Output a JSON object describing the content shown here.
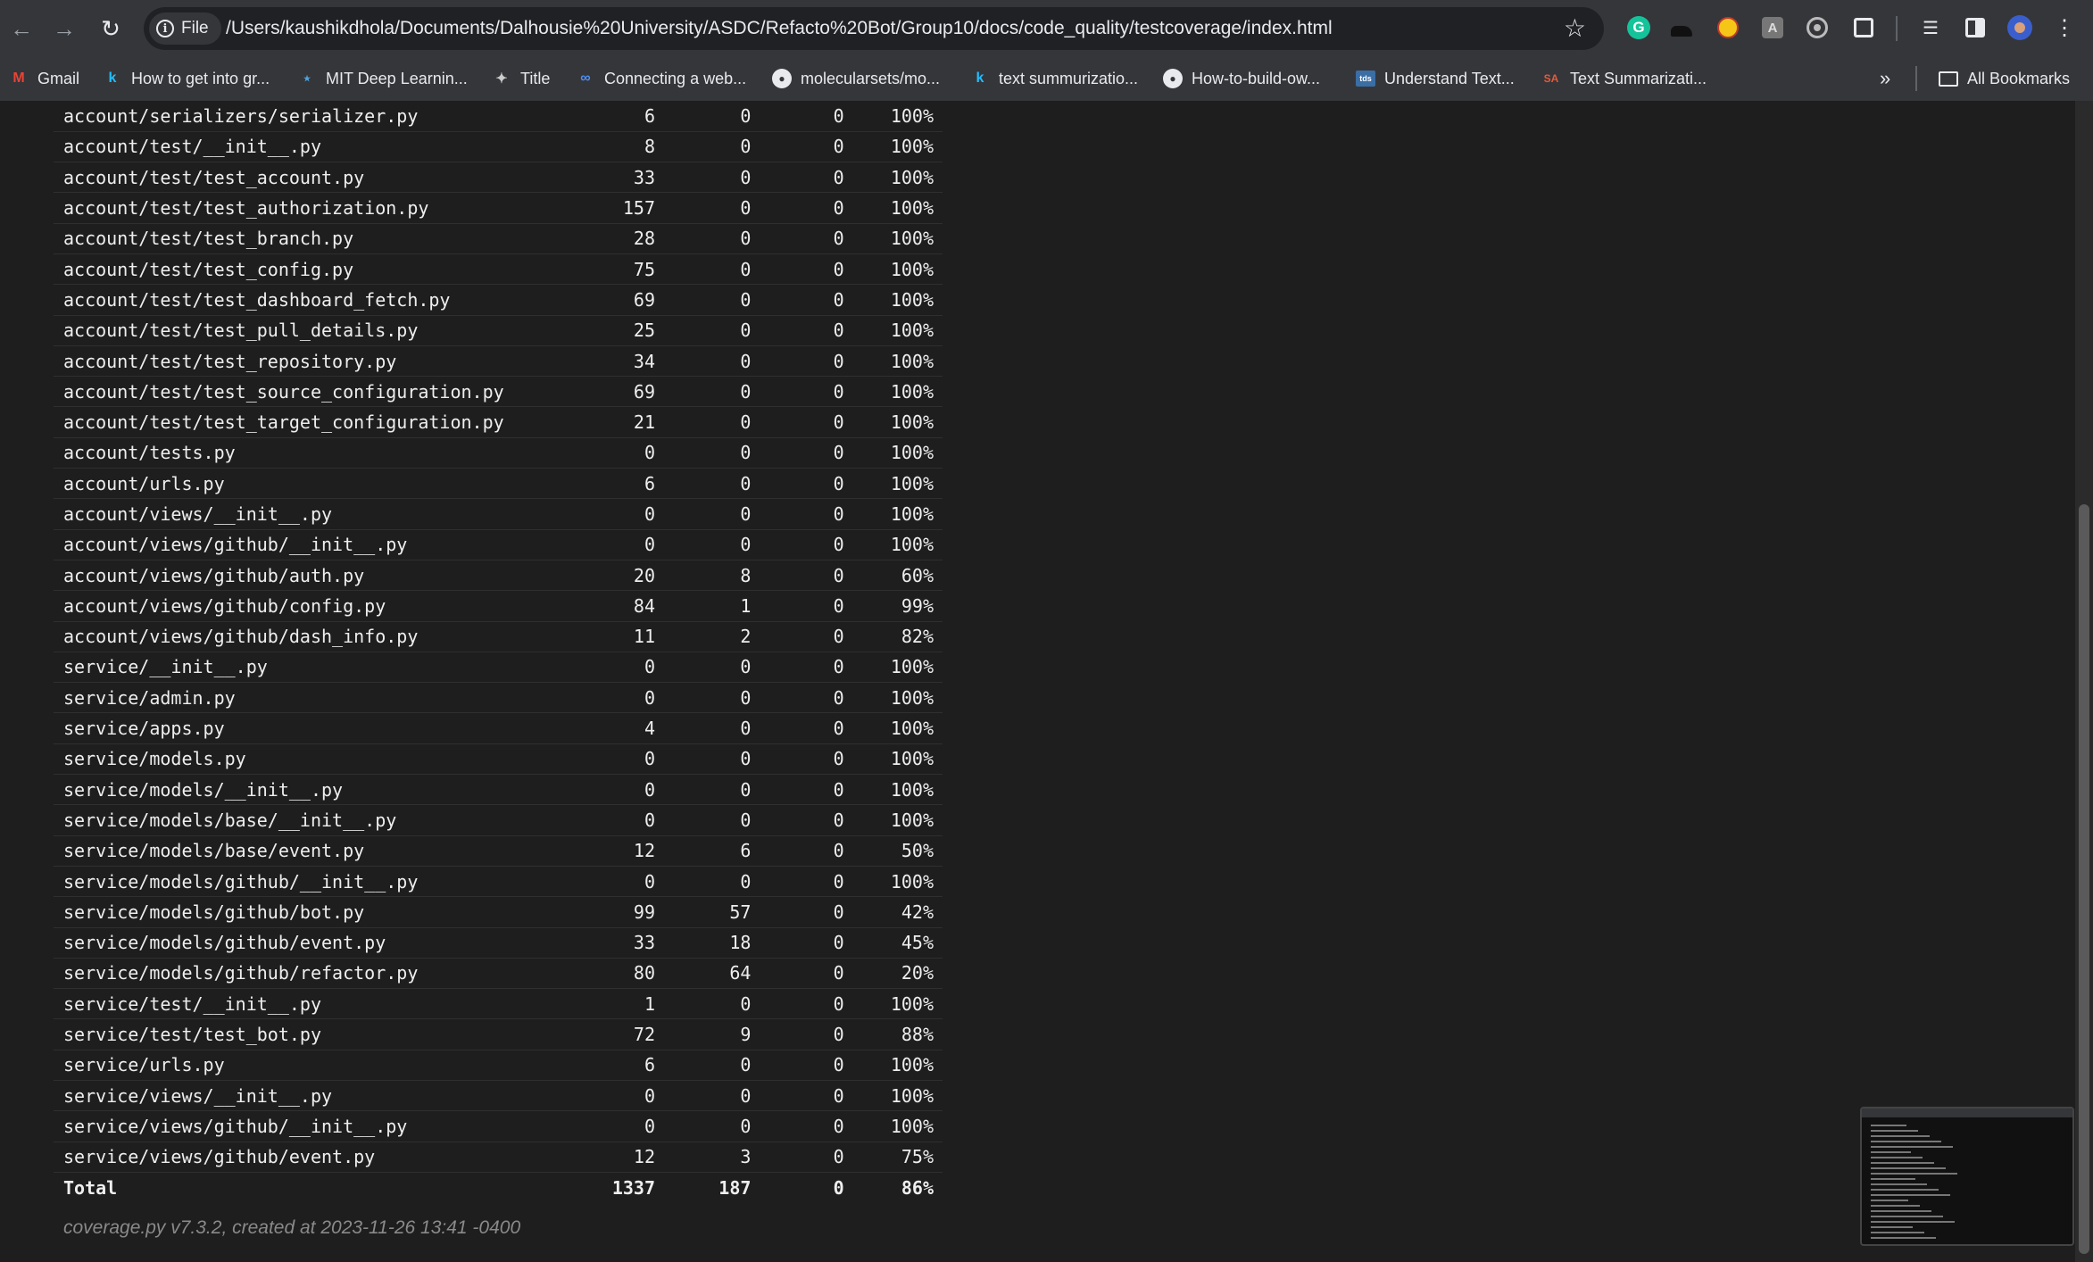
{
  "browser": {
    "file_chip_label": "File",
    "url": "/Users/kaushikdhola/Documents/Dalhousie%20University/ASDC/Refacto%20Bot/Group10/docs/code_quality/testcoverage/index.html",
    "bookmarks": [
      {
        "label": "Gmail",
        "icon": "gmail-icon"
      },
      {
        "label": "How to get into gr...",
        "icon": "k-icon"
      },
      {
        "label": "MIT Deep Learnin...",
        "icon": "network-icon"
      },
      {
        "label": "Title",
        "icon": "bird-icon"
      },
      {
        "label": "Connecting a web...",
        "icon": "meta-icon"
      },
      {
        "label": "molecularsets/mo...",
        "icon": "github-icon"
      },
      {
        "label": "text summurizatio...",
        "icon": "k-icon"
      },
      {
        "label": "How-to-build-ow...",
        "icon": "github-icon"
      },
      {
        "label": "Understand Text...",
        "icon": "tds-icon"
      },
      {
        "label": "Text Summarizati...",
        "icon": "sa-icon"
      }
    ],
    "all_bookmarks_label": "All Bookmarks"
  },
  "coverage": {
    "rows": [
      {
        "module": "account/serializers/serializer.py",
        "statements": "6",
        "missing": "0",
        "excluded": "0",
        "coverage": "100%"
      },
      {
        "module": "account/test/__init__.py",
        "statements": "8",
        "missing": "0",
        "excluded": "0",
        "coverage": "100%"
      },
      {
        "module": "account/test/test_account.py",
        "statements": "33",
        "missing": "0",
        "excluded": "0",
        "coverage": "100%"
      },
      {
        "module": "account/test/test_authorization.py",
        "statements": "157",
        "missing": "0",
        "excluded": "0",
        "coverage": "100%"
      },
      {
        "module": "account/test/test_branch.py",
        "statements": "28",
        "missing": "0",
        "excluded": "0",
        "coverage": "100%"
      },
      {
        "module": "account/test/test_config.py",
        "statements": "75",
        "missing": "0",
        "excluded": "0",
        "coverage": "100%"
      },
      {
        "module": "account/test/test_dashboard_fetch.py",
        "statements": "69",
        "missing": "0",
        "excluded": "0",
        "coverage": "100%"
      },
      {
        "module": "account/test/test_pull_details.py",
        "statements": "25",
        "missing": "0",
        "excluded": "0",
        "coverage": "100%"
      },
      {
        "module": "account/test/test_repository.py",
        "statements": "34",
        "missing": "0",
        "excluded": "0",
        "coverage": "100%"
      },
      {
        "module": "account/test/test_source_configuration.py",
        "statements": "69",
        "missing": "0",
        "excluded": "0",
        "coverage": "100%"
      },
      {
        "module": "account/test/test_target_configuration.py",
        "statements": "21",
        "missing": "0",
        "excluded": "0",
        "coverage": "100%"
      },
      {
        "module": "account/tests.py",
        "statements": "0",
        "missing": "0",
        "excluded": "0",
        "coverage": "100%"
      },
      {
        "module": "account/urls.py",
        "statements": "6",
        "missing": "0",
        "excluded": "0",
        "coverage": "100%"
      },
      {
        "module": "account/views/__init__.py",
        "statements": "0",
        "missing": "0",
        "excluded": "0",
        "coverage": "100%"
      },
      {
        "module": "account/views/github/__init__.py",
        "statements": "0",
        "missing": "0",
        "excluded": "0",
        "coverage": "100%"
      },
      {
        "module": "account/views/github/auth.py",
        "statements": "20",
        "missing": "8",
        "excluded": "0",
        "coverage": "60%"
      },
      {
        "module": "account/views/github/config.py",
        "statements": "84",
        "missing": "1",
        "excluded": "0",
        "coverage": "99%"
      },
      {
        "module": "account/views/github/dash_info.py",
        "statements": "11",
        "missing": "2",
        "excluded": "0",
        "coverage": "82%"
      },
      {
        "module": "service/__init__.py",
        "statements": "0",
        "missing": "0",
        "excluded": "0",
        "coverage": "100%"
      },
      {
        "module": "service/admin.py",
        "statements": "0",
        "missing": "0",
        "excluded": "0",
        "coverage": "100%"
      },
      {
        "module": "service/apps.py",
        "statements": "4",
        "missing": "0",
        "excluded": "0",
        "coverage": "100%"
      },
      {
        "module": "service/models.py",
        "statements": "0",
        "missing": "0",
        "excluded": "0",
        "coverage": "100%"
      },
      {
        "module": "service/models/__init__.py",
        "statements": "0",
        "missing": "0",
        "excluded": "0",
        "coverage": "100%"
      },
      {
        "module": "service/models/base/__init__.py",
        "statements": "0",
        "missing": "0",
        "excluded": "0",
        "coverage": "100%"
      },
      {
        "module": "service/models/base/event.py",
        "statements": "12",
        "missing": "6",
        "excluded": "0",
        "coverage": "50%"
      },
      {
        "module": "service/models/github/__init__.py",
        "statements": "0",
        "missing": "0",
        "excluded": "0",
        "coverage": "100%"
      },
      {
        "module": "service/models/github/bot.py",
        "statements": "99",
        "missing": "57",
        "excluded": "0",
        "coverage": "42%"
      },
      {
        "module": "service/models/github/event.py",
        "statements": "33",
        "missing": "18",
        "excluded": "0",
        "coverage": "45%"
      },
      {
        "module": "service/models/github/refactor.py",
        "statements": "80",
        "missing": "64",
        "excluded": "0",
        "coverage": "20%"
      },
      {
        "module": "service/test/__init__.py",
        "statements": "1",
        "missing": "0",
        "excluded": "0",
        "coverage": "100%"
      },
      {
        "module": "service/test/test_bot.py",
        "statements": "72",
        "missing": "9",
        "excluded": "0",
        "coverage": "88%"
      },
      {
        "module": "service/urls.py",
        "statements": "6",
        "missing": "0",
        "excluded": "0",
        "coverage": "100%"
      },
      {
        "module": "service/views/__init__.py",
        "statements": "0",
        "missing": "0",
        "excluded": "0",
        "coverage": "100%"
      },
      {
        "module": "service/views/github/__init__.py",
        "statements": "0",
        "missing": "0",
        "excluded": "0",
        "coverage": "100%"
      },
      {
        "module": "service/views/github/event.py",
        "statements": "12",
        "missing": "3",
        "excluded": "0",
        "coverage": "75%"
      }
    ],
    "total": {
      "label": "Total",
      "statements": "1337",
      "missing": "187",
      "excluded": "0",
      "coverage": "86%"
    },
    "footer": "coverage.py v7.3.2, created at 2023-11-26 13:41 -0400"
  },
  "colors": {
    "page_background": "#1e1e1e",
    "chrome_background": "#35363a",
    "text": "#eeeeee",
    "footer_text": "#8a8a8a"
  }
}
